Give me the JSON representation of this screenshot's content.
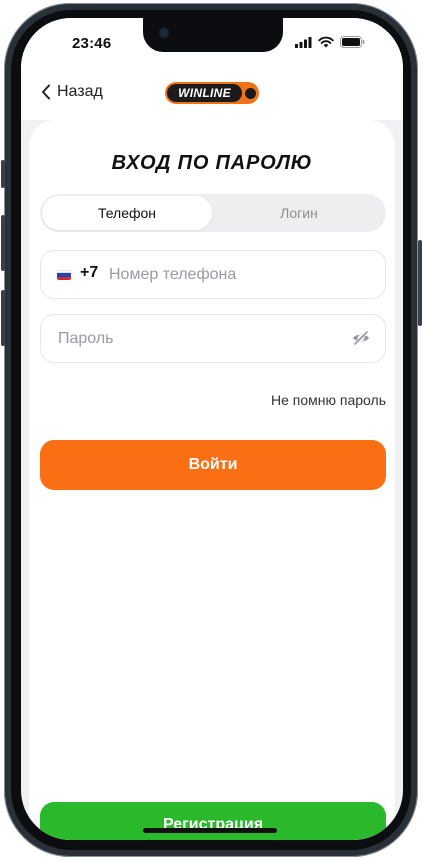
{
  "status_bar": {
    "time": "23:46"
  },
  "header": {
    "back_label": "Назад",
    "logo_text": "WINLINE"
  },
  "login": {
    "title": "ВХОД ПО ПАРОЛЮ",
    "tabs": [
      {
        "label": "Телефон",
        "active": true
      },
      {
        "label": "Логин",
        "active": false
      }
    ],
    "phone": {
      "prefix": "+7",
      "placeholder": "Номер телефона"
    },
    "password": {
      "placeholder": "Пароль"
    },
    "forgot_label": "Не помню пароль",
    "submit_label": "Войти",
    "register_label": "Регистрация"
  },
  "colors": {
    "accent_orange": "#fa6f13",
    "register_green": "#29b92b",
    "logo_orange": "#f07219"
  },
  "icons": {
    "back": "chevron-left-icon",
    "flag": "russia-flag-icon",
    "password_toggle": "eye-off-icon",
    "signal": "cellular-signal-icon",
    "wifi": "wifi-icon",
    "battery": "battery-icon"
  }
}
